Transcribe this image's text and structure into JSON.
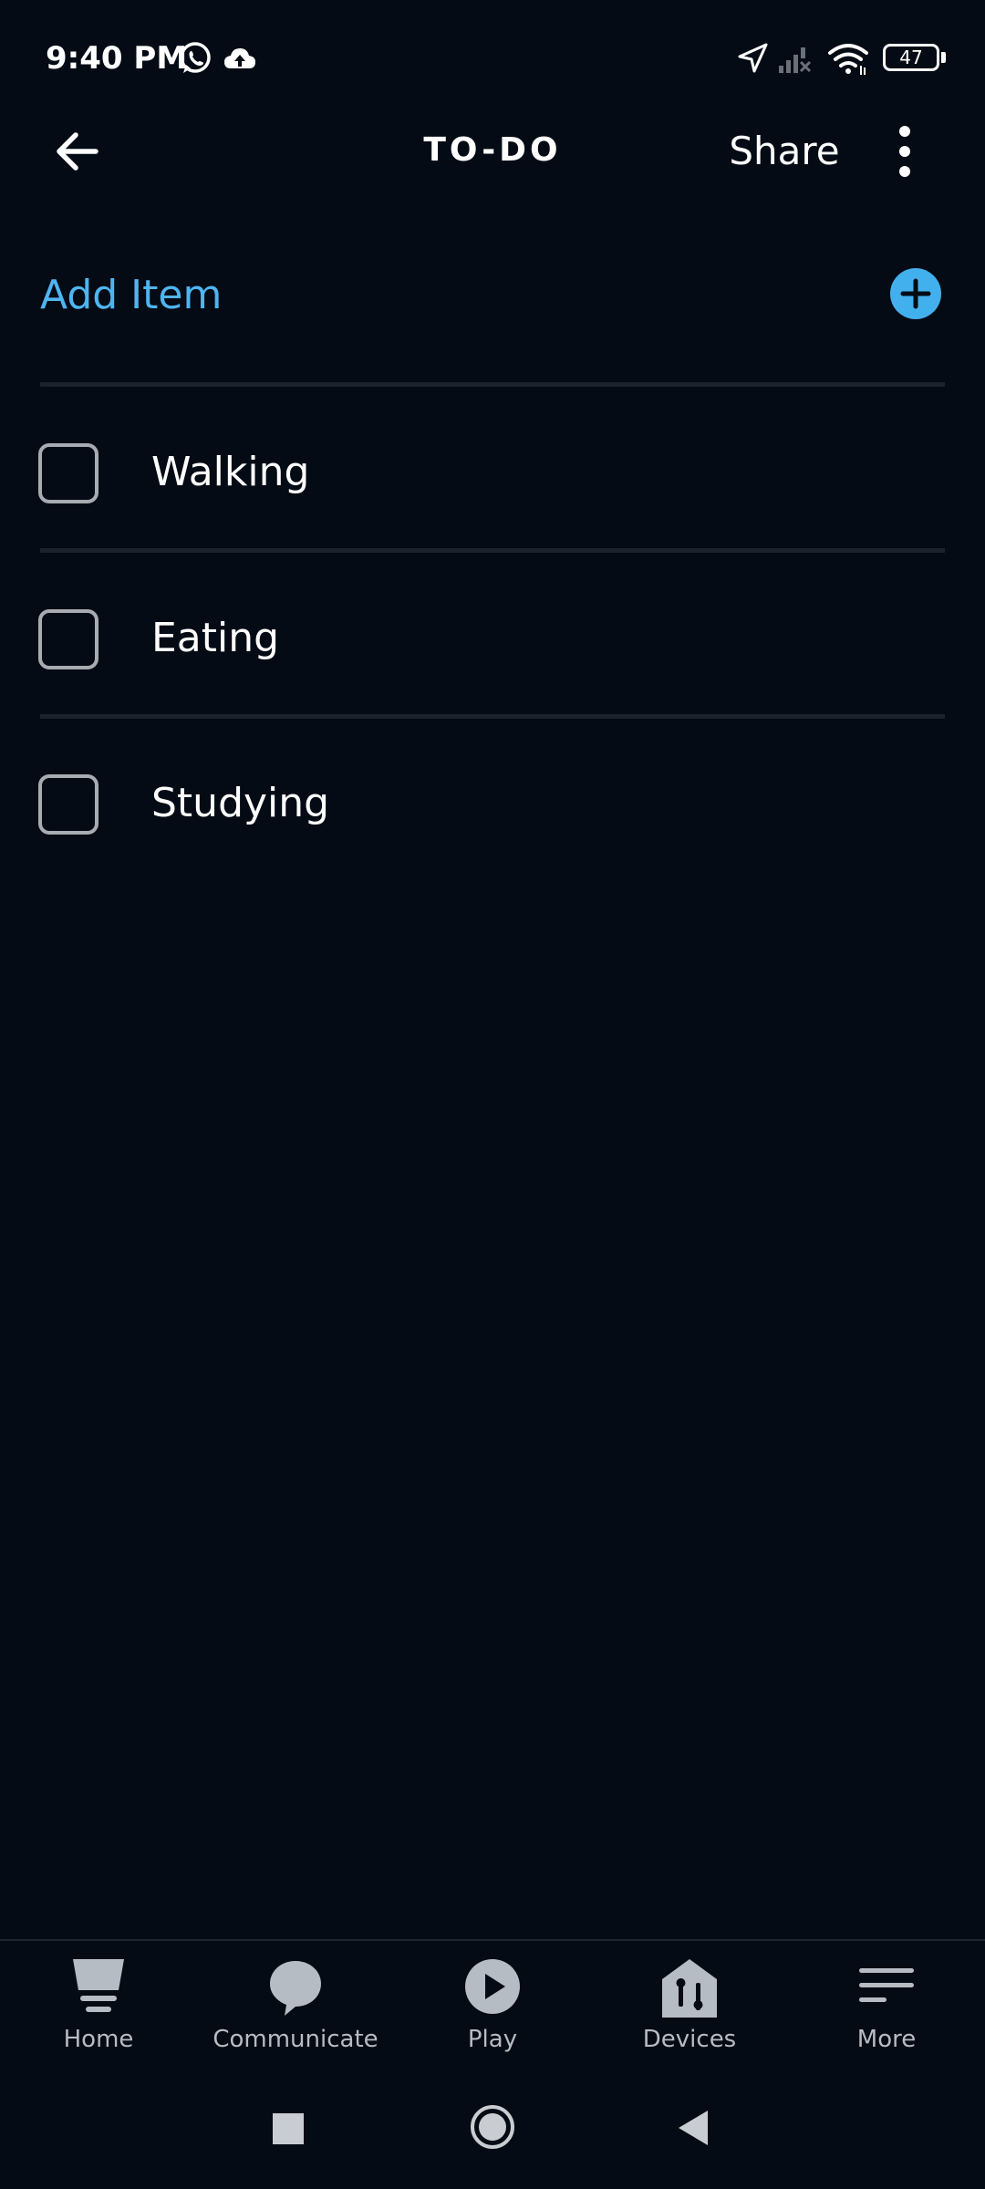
{
  "status_bar": {
    "time": "9:40 PM",
    "battery": "47",
    "icons": [
      "whatsapp-icon",
      "cloud-upload-icon",
      "location-arrow-icon",
      "signal-icon",
      "wifi-icon",
      "battery-icon"
    ]
  },
  "header": {
    "title": "TO-DO",
    "share_label": "Share",
    "back_icon": "back-arrow-icon",
    "more_icon": "more-vertical-icon"
  },
  "add_item": {
    "label": "Add Item",
    "icon": "plus-circle-icon",
    "accent_color": "#4fb5f0"
  },
  "todo_items": [
    {
      "label": "Walking",
      "checked": false
    },
    {
      "label": "Eating",
      "checked": false
    },
    {
      "label": "Studying",
      "checked": false
    }
  ],
  "bottom_nav": {
    "items": [
      {
        "label": "Home",
        "icon": "home-icon"
      },
      {
        "label": "Communicate",
        "icon": "chat-bubble-icon"
      },
      {
        "label": "Play",
        "icon": "play-icon"
      },
      {
        "label": "Devices",
        "icon": "devices-house-icon"
      },
      {
        "label": "More",
        "icon": "menu-lines-icon"
      }
    ]
  },
  "system_nav": {
    "icons": [
      "recents-square-icon",
      "home-circle-icon",
      "back-triangle-icon"
    ]
  },
  "colors": {
    "background": "#040b14",
    "divider": "#1b222b",
    "checkbox_border": "#a7acb3",
    "nav_icon": "#b6bcc3"
  }
}
